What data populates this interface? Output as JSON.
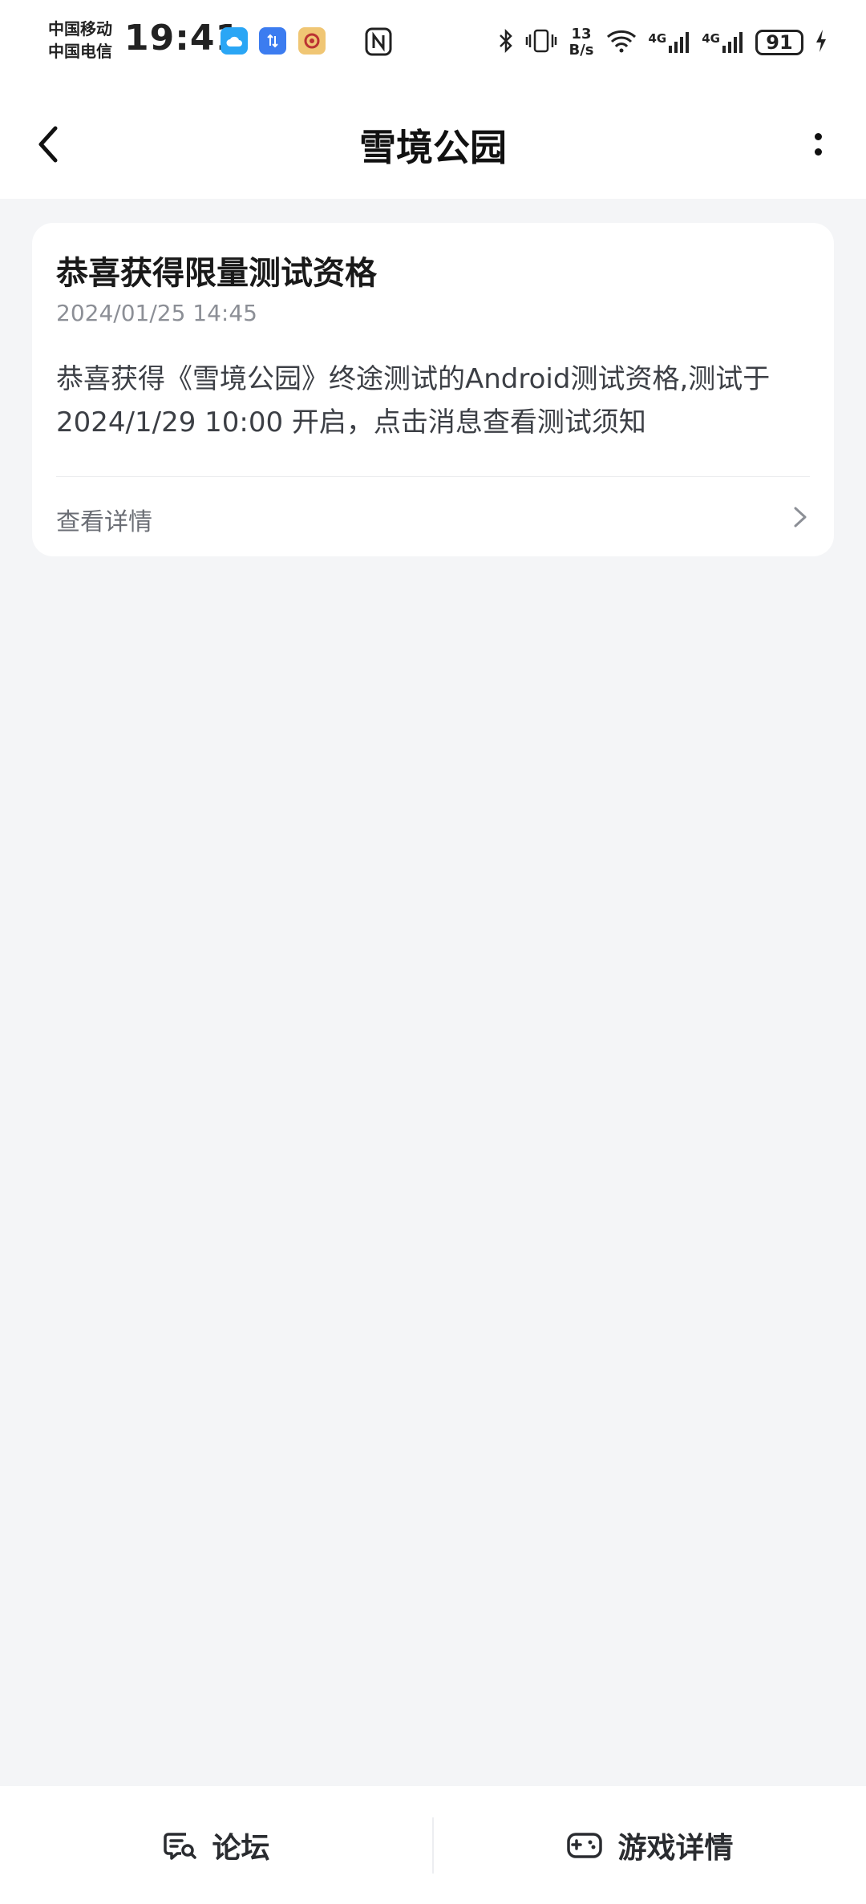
{
  "status_bar": {
    "carrier_1": "中国移动",
    "carrier_2": "中国电信",
    "time": "19:41",
    "net_speed_value": "13",
    "net_speed_unit": "B/s",
    "network_1": "4G",
    "network_2": "4G",
    "battery": "91"
  },
  "header": {
    "title": "雪境公园"
  },
  "message": {
    "title": "恭喜获得限量测试资格",
    "timestamp": "2024/01/25 14:45",
    "body": "恭喜获得《雪境公园》终途测试的Android测试资格,测试于2024/1/29 10:00 开启，点击消息查看测试须知",
    "details_label": "查看详情"
  },
  "bottom_nav": {
    "forum_label": "论坛",
    "game_details_label": "游戏详情"
  },
  "colors": {
    "background": "#f4f5f7",
    "card": "#ffffff",
    "secondary_text": "#8c8f96"
  }
}
